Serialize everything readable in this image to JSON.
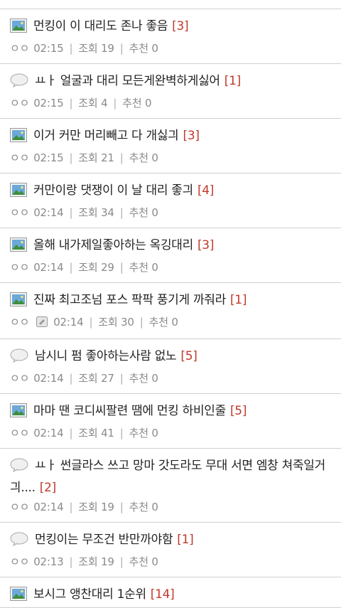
{
  "posts": [
    {
      "icon": "image-icon",
      "title": "먼킹이 이 대리도 존나 좋음",
      "count": "[3]",
      "author": "ㅇㅇ",
      "time": "02:15",
      "views": "조회 19",
      "recommend": "추천 0",
      "attach": false
    },
    {
      "icon": "comment-icon",
      "title": "ㅛㅏ 얼굴과 대리 모든게완벽하게싫어",
      "count": "[1]",
      "author": "ㅇㅇ",
      "time": "02:15",
      "views": "조회 4",
      "recommend": "추천 0",
      "attach": false
    },
    {
      "icon": "image-icon",
      "title": "이거 커만 머리빼고 다 개싫긔",
      "count": "[3]",
      "author": "ㅇㅇ",
      "time": "02:15",
      "views": "조회 21",
      "recommend": "추천 0",
      "attach": false
    },
    {
      "icon": "image-icon",
      "title": "커만이랑 댓쟁이 이 날 대리 좋긔",
      "count": "[4]",
      "author": "ㅇㅇ",
      "time": "02:14",
      "views": "조회 34",
      "recommend": "추천 0",
      "attach": false
    },
    {
      "icon": "image-icon",
      "title": "올해 내가제일좋아하는 옥깅대리",
      "count": "[3]",
      "author": "ㅇㅇ",
      "time": "02:14",
      "views": "조회 29",
      "recommend": "추천 0",
      "attach": false
    },
    {
      "icon": "image-icon",
      "title": "진짜 최고조넘 포스 팍팍 풍기게 까줘라",
      "count": "[1]",
      "author": "ㅇㅇ",
      "time": "02:14",
      "views": "조회 30",
      "recommend": "추천 0",
      "attach": true
    },
    {
      "icon": "comment-icon",
      "title": "남시니 펌 좋아하는사람 없노",
      "count": "[5]",
      "author": "ㅇㅇ",
      "time": "02:14",
      "views": "조회 27",
      "recommend": "추천 0",
      "attach": false
    },
    {
      "icon": "image-icon",
      "title": "마마 땐 코디씨팔련 땜에 먼킹 하비인줄",
      "count": "[5]",
      "author": "ㅇㅇ",
      "time": "02:14",
      "views": "조회 41",
      "recommend": "추천 0",
      "attach": false
    },
    {
      "icon": "comment-icon",
      "title": "ㅛㅏ 썬글라스 쓰고 망마 갓도라도 무대 서면 엠창 쳐죽일거긔....",
      "count": "[2]",
      "author": "ㅇㅇ",
      "time": "02:14",
      "views": "조회 19",
      "recommend": "추천 0",
      "attach": false
    },
    {
      "icon": "comment-icon",
      "title": "먼킹이는 무조건 반만까야함",
      "count": "[1]",
      "author": "ㅇㅇ",
      "time": "02:13",
      "views": "조회 19",
      "recommend": "추천 0",
      "attach": false
    },
    {
      "icon": "image-icon",
      "title": "보시그 앵찬대리 1순위",
      "count": "[14]",
      "author": "",
      "time": "",
      "views": "",
      "recommend": "",
      "attach": false
    }
  ]
}
